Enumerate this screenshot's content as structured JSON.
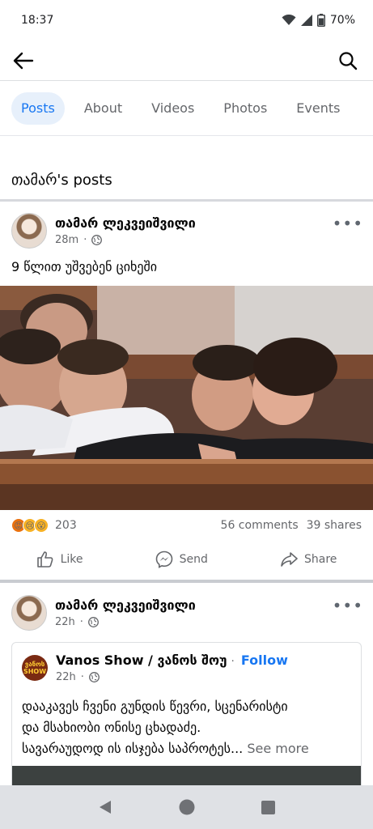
{
  "status": {
    "time": "18:37",
    "battery": "70%"
  },
  "tabs": [
    {
      "label": "Posts",
      "active": true
    },
    {
      "label": "About"
    },
    {
      "label": "Videos"
    },
    {
      "label": "Photos"
    },
    {
      "label": "Events"
    }
  ],
  "section_title": "თამარ's posts",
  "posts": [
    {
      "author": "თამარ ლეკვეიშვილი",
      "time": "28m",
      "text": "9 წლით უშვებენ ციხეში",
      "reactions_count": "203",
      "comments": "56 comments",
      "shares": "39 shares"
    },
    {
      "author": "თამარ ლეკვეიშვილი",
      "time": "22h",
      "shared": {
        "page_name": "Vanos Show / ვანოს შოუ",
        "follow_label": "Follow",
        "logo_text": "ვანოს SHOW",
        "time": "22h",
        "text_line1": "დააკავეს ჩვენი გუნდის წევრი, სცენარისტი",
        "text_line2": "და მსახიობი ონისე ცხადაძე.",
        "text_line3": "სავარაუდოდ ის ისჯება საპროტეს...",
        "see_more": "See more"
      }
    }
  ],
  "actions": {
    "like": "Like",
    "send": "Send",
    "share": "Share"
  },
  "colors": {
    "accent": "#1877f2",
    "tab_active_bg": "#e7f0fb"
  }
}
